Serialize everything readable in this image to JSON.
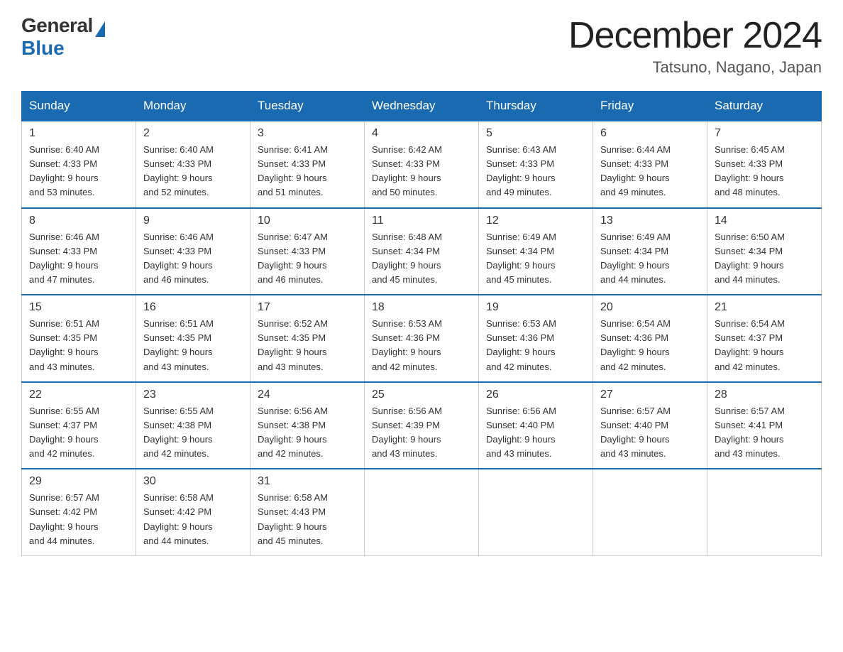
{
  "logo": {
    "general": "General",
    "blue": "Blue"
  },
  "title": "December 2024",
  "subtitle": "Tatsuno, Nagano, Japan",
  "weekdays": [
    "Sunday",
    "Monday",
    "Tuesday",
    "Wednesday",
    "Thursday",
    "Friday",
    "Saturday"
  ],
  "weeks": [
    [
      {
        "day": "1",
        "sunrise": "6:40 AM",
        "sunset": "4:33 PM",
        "daylight": "9 hours and 53 minutes."
      },
      {
        "day": "2",
        "sunrise": "6:40 AM",
        "sunset": "4:33 PM",
        "daylight": "9 hours and 52 minutes."
      },
      {
        "day": "3",
        "sunrise": "6:41 AM",
        "sunset": "4:33 PM",
        "daylight": "9 hours and 51 minutes."
      },
      {
        "day": "4",
        "sunrise": "6:42 AM",
        "sunset": "4:33 PM",
        "daylight": "9 hours and 50 minutes."
      },
      {
        "day": "5",
        "sunrise": "6:43 AM",
        "sunset": "4:33 PM",
        "daylight": "9 hours and 49 minutes."
      },
      {
        "day": "6",
        "sunrise": "6:44 AM",
        "sunset": "4:33 PM",
        "daylight": "9 hours and 49 minutes."
      },
      {
        "day": "7",
        "sunrise": "6:45 AM",
        "sunset": "4:33 PM",
        "daylight": "9 hours and 48 minutes."
      }
    ],
    [
      {
        "day": "8",
        "sunrise": "6:46 AM",
        "sunset": "4:33 PM",
        "daylight": "9 hours and 47 minutes."
      },
      {
        "day": "9",
        "sunrise": "6:46 AM",
        "sunset": "4:33 PM",
        "daylight": "9 hours and 46 minutes."
      },
      {
        "day": "10",
        "sunrise": "6:47 AM",
        "sunset": "4:33 PM",
        "daylight": "9 hours and 46 minutes."
      },
      {
        "day": "11",
        "sunrise": "6:48 AM",
        "sunset": "4:34 PM",
        "daylight": "9 hours and 45 minutes."
      },
      {
        "day": "12",
        "sunrise": "6:49 AM",
        "sunset": "4:34 PM",
        "daylight": "9 hours and 45 minutes."
      },
      {
        "day": "13",
        "sunrise": "6:49 AM",
        "sunset": "4:34 PM",
        "daylight": "9 hours and 44 minutes."
      },
      {
        "day": "14",
        "sunrise": "6:50 AM",
        "sunset": "4:34 PM",
        "daylight": "9 hours and 44 minutes."
      }
    ],
    [
      {
        "day": "15",
        "sunrise": "6:51 AM",
        "sunset": "4:35 PM",
        "daylight": "9 hours and 43 minutes."
      },
      {
        "day": "16",
        "sunrise": "6:51 AM",
        "sunset": "4:35 PM",
        "daylight": "9 hours and 43 minutes."
      },
      {
        "day": "17",
        "sunrise": "6:52 AM",
        "sunset": "4:35 PM",
        "daylight": "9 hours and 43 minutes."
      },
      {
        "day": "18",
        "sunrise": "6:53 AM",
        "sunset": "4:36 PM",
        "daylight": "9 hours and 42 minutes."
      },
      {
        "day": "19",
        "sunrise": "6:53 AM",
        "sunset": "4:36 PM",
        "daylight": "9 hours and 42 minutes."
      },
      {
        "day": "20",
        "sunrise": "6:54 AM",
        "sunset": "4:36 PM",
        "daylight": "9 hours and 42 minutes."
      },
      {
        "day": "21",
        "sunrise": "6:54 AM",
        "sunset": "4:37 PM",
        "daylight": "9 hours and 42 minutes."
      }
    ],
    [
      {
        "day": "22",
        "sunrise": "6:55 AM",
        "sunset": "4:37 PM",
        "daylight": "9 hours and 42 minutes."
      },
      {
        "day": "23",
        "sunrise": "6:55 AM",
        "sunset": "4:38 PM",
        "daylight": "9 hours and 42 minutes."
      },
      {
        "day": "24",
        "sunrise": "6:56 AM",
        "sunset": "4:38 PM",
        "daylight": "9 hours and 42 minutes."
      },
      {
        "day": "25",
        "sunrise": "6:56 AM",
        "sunset": "4:39 PM",
        "daylight": "9 hours and 43 minutes."
      },
      {
        "day": "26",
        "sunrise": "6:56 AM",
        "sunset": "4:40 PM",
        "daylight": "9 hours and 43 minutes."
      },
      {
        "day": "27",
        "sunrise": "6:57 AM",
        "sunset": "4:40 PM",
        "daylight": "9 hours and 43 minutes."
      },
      {
        "day": "28",
        "sunrise": "6:57 AM",
        "sunset": "4:41 PM",
        "daylight": "9 hours and 43 minutes."
      }
    ],
    [
      {
        "day": "29",
        "sunrise": "6:57 AM",
        "sunset": "4:42 PM",
        "daylight": "9 hours and 44 minutes."
      },
      {
        "day": "30",
        "sunrise": "6:58 AM",
        "sunset": "4:42 PM",
        "daylight": "9 hours and 44 minutes."
      },
      {
        "day": "31",
        "sunrise": "6:58 AM",
        "sunset": "4:43 PM",
        "daylight": "9 hours and 45 minutes."
      },
      null,
      null,
      null,
      null
    ]
  ],
  "labels": {
    "sunrise": "Sunrise:",
    "sunset": "Sunset:",
    "daylight": "Daylight:"
  }
}
